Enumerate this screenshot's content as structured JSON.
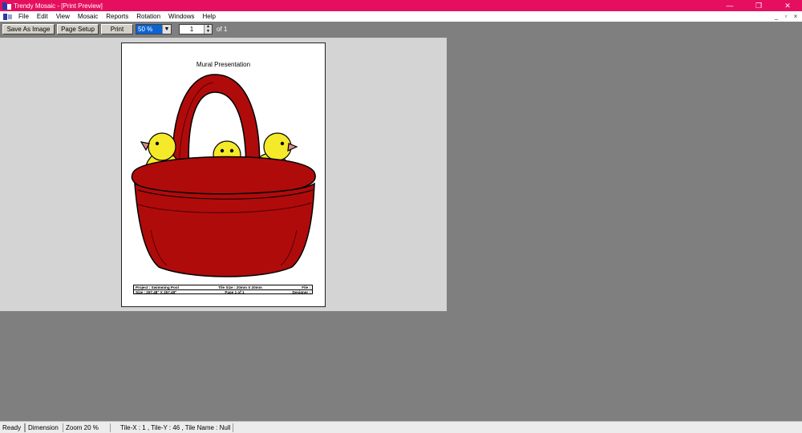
{
  "window": {
    "title": "Trendy Mosaic - [Print Preview]",
    "controls": {
      "minimize": "—",
      "restore": "❐",
      "close": "✕"
    }
  },
  "menu": {
    "items": [
      "File",
      "Edit",
      "View",
      "Mosaic",
      "Reports",
      "Rotation",
      "Windows",
      "Help"
    ],
    "mdi": {
      "minimize": "_",
      "restore": "▫",
      "close": "×"
    }
  },
  "toolbar": {
    "save_as_image": "Save As Image",
    "page_setup": "Page Setup",
    "print": "Print",
    "zoom_value": "50 %",
    "zoom_arrow": "▼",
    "page_number": "1",
    "page_total": "of 1"
  },
  "page": {
    "title": "Mural Presentation",
    "info": {
      "project": "Project : Swimming Pool",
      "tile_size": "Tile Size : 20mm X 20mm",
      "file": "File :",
      "size": "Size : 257.48\" X 257.48\"",
      "page_of": "Page 1 of 1",
      "designer": "Designer :"
    }
  },
  "status": {
    "ready": "Ready",
    "dimension": "Dimension",
    "zoom": "Zoom 20 %",
    "tile_info": "Tile-X : 1 , Tile-Y : 46 , Tile Name : Null"
  },
  "colors": {
    "titlebar": "#e60f5f",
    "basket_red": "#b00b0b",
    "chick_yellow": "#f5ea2a",
    "workspace_gray": "#7f7f7f"
  }
}
